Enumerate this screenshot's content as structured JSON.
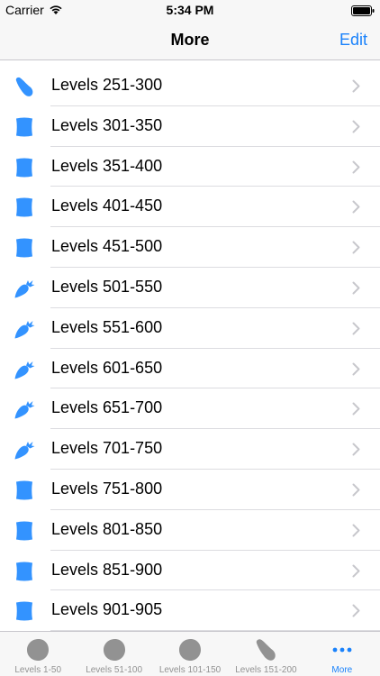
{
  "status_bar": {
    "carrier": "Carrier",
    "time": "5:34 PM"
  },
  "nav": {
    "title": "More",
    "edit_label": "Edit"
  },
  "colors": {
    "accent": "#1a82fb",
    "icon_blue": "#3393ff",
    "tab_inactive": "#929292"
  },
  "rows": [
    {
      "label": "Levels 251-300",
      "icon": "bean-icon"
    },
    {
      "label": "Levels 301-350",
      "icon": "square-icon"
    },
    {
      "label": "Levels 351-400",
      "icon": "square-icon"
    },
    {
      "label": "Levels 401-450",
      "icon": "square-icon"
    },
    {
      "label": "Levels 451-500",
      "icon": "square-icon"
    },
    {
      "label": "Levels 501-550",
      "icon": "carrot-icon"
    },
    {
      "label": "Levels 551-600",
      "icon": "carrot-icon"
    },
    {
      "label": "Levels 601-650",
      "icon": "carrot-icon"
    },
    {
      "label": "Levels 651-700",
      "icon": "carrot-icon"
    },
    {
      "label": "Levels 701-750",
      "icon": "carrot-icon"
    },
    {
      "label": "Levels 751-800",
      "icon": "square-icon"
    },
    {
      "label": "Levels 801-850",
      "icon": "square-icon"
    },
    {
      "label": "Levels 851-900",
      "icon": "square-icon"
    },
    {
      "label": "Levels 901-905",
      "icon": "square-icon"
    }
  ],
  "tabs": [
    {
      "label": "Levels 1-50",
      "icon": "circle-icon"
    },
    {
      "label": "Levels 51-100",
      "icon": "circle-icon"
    },
    {
      "label": "Levels 101-150",
      "icon": "circle-icon"
    },
    {
      "label": "Levels 151-200",
      "icon": "bean-icon"
    },
    {
      "label": "More",
      "icon": "more-dots-icon",
      "active": true
    }
  ]
}
